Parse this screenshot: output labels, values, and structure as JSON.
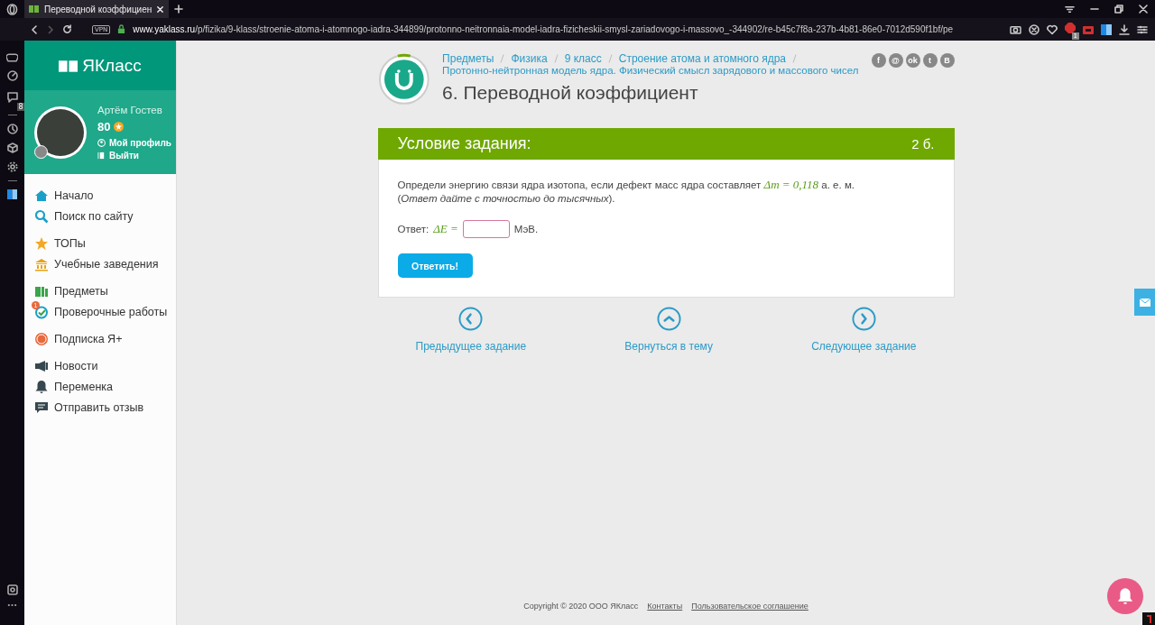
{
  "browser": {
    "tab": {
      "title": "Переводной коэффициен",
      "selected": true
    },
    "url": {
      "domain": "www.yaklass.ru",
      "path": "/p/fizika/9-klass/stroenie-atoma-i-atomnogo-iadra-344899/protonno-neitronnaia-model-iadra-fizicheskii-smysl-zariadovogo-i-massovo_-344902/re-b45c7f8a-237b-4b81-86e0-7012d590f1bf/pe"
    },
    "vpn": "VPN",
    "adblock_badge": "1",
    "rail_badge": "8"
  },
  "site": {
    "logo": "ЯКласс",
    "user": {
      "name": "Артём Гостев",
      "score": "80",
      "links": [
        {
          "kind": "profile",
          "label": "Мой профиль"
        },
        {
          "kind": "logout",
          "label": "Выйти"
        }
      ]
    },
    "menu": [
      [
        {
          "kind": "home",
          "label": "Начало"
        },
        {
          "kind": "search",
          "label": "Поиск по сайту"
        }
      ],
      [
        {
          "kind": "star",
          "label": "ТОПы"
        },
        {
          "kind": "school",
          "label": "Учебные заведения"
        }
      ],
      [
        {
          "kind": "books",
          "label": "Предметы"
        },
        {
          "kind": "check",
          "label": "Проверочные работы",
          "badge": "1"
        }
      ],
      [
        {
          "kind": "plus",
          "label": "Подписка Я+"
        }
      ],
      [
        {
          "kind": "news",
          "label": "Новости"
        },
        {
          "kind": "bell",
          "label": "Переменка"
        },
        {
          "kind": "chat",
          "label": "Отправить отзыв"
        }
      ]
    ]
  },
  "breadcrumbs": [
    "Предметы",
    "Физика",
    "9 класс",
    "Строение атома и атомного ядра",
    "Протонно-нейтронная модель ядра. Физический смысл зарядового и массового чисел"
  ],
  "title": "6. Переводной коэффициент",
  "social": [
    "f",
    "@",
    "ok",
    "t",
    "B"
  ],
  "task": {
    "header": "Условие задания:",
    "points": "2 б.",
    "question": {
      "before": "Определи энергию связи ядра изотопа, если дефект масс ядра составляет",
      "formula": "Δm = 0,118",
      "after": "а. е. м."
    },
    "note": "(*Ответ дайте с точностью до тысячных*).",
    "answer": {
      "label": "Ответ:",
      "formula": "ΔE =",
      "unit": "МэВ."
    },
    "submit": "Ответить!"
  },
  "nav": [
    {
      "kind": "prev",
      "label": "Предыдущее задание"
    },
    {
      "kind": "up",
      "label": "Вернуться в тему"
    },
    {
      "kind": "next",
      "label": "Следующее задание"
    }
  ],
  "footer": {
    "copyright": "Copyright © 2020 ООО ЯКласс",
    "links": [
      "Контакты",
      "Пользовательское соглашение"
    ]
  }
}
